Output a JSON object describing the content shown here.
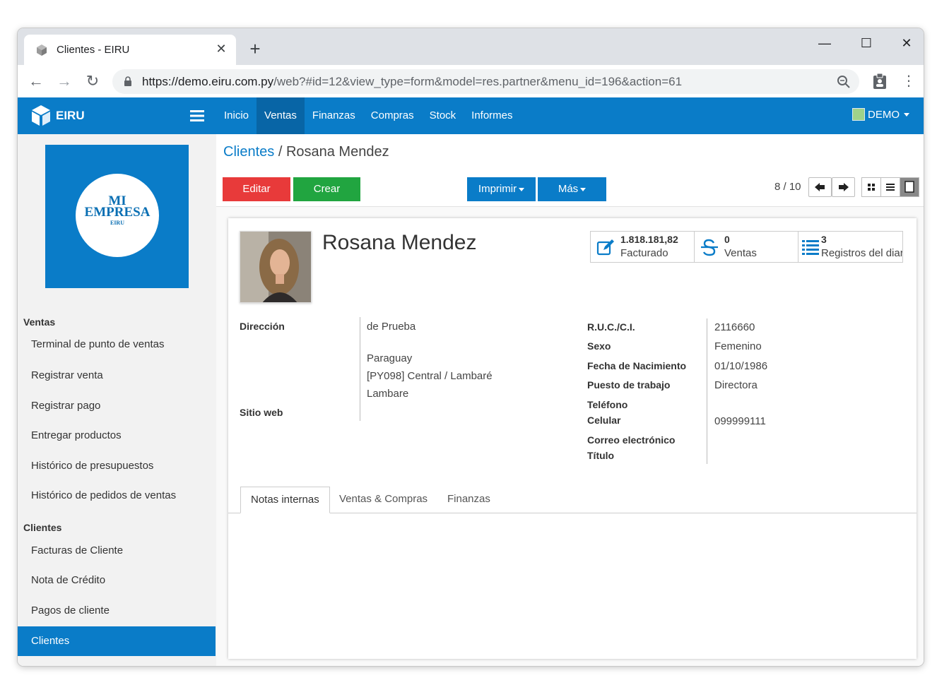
{
  "browser": {
    "tab_title": "Clientes - EIRU",
    "url_host": "https://demo.eiru.com.py",
    "url_rest": "/web?#id=12&view_type=form&model=res.partner&menu_id=196&action=61"
  },
  "navbar": {
    "brand": "EIRU",
    "menu": [
      "Inicio",
      "Ventas",
      "Finanzas",
      "Compras",
      "Stock",
      "Informes"
    ],
    "active_menu": "Ventas",
    "user": "DEMO"
  },
  "sidebar": {
    "logo": {
      "line1": "MI",
      "line2": "EMPRESA",
      "line3": "EIRU"
    },
    "sections": [
      {
        "title": "Ventas",
        "items": [
          "Terminal de punto de ventas",
          "Registrar venta",
          "Registrar pago",
          "Entregar productos",
          "Histórico de presupuestos",
          "Histórico de pedidos de ventas"
        ]
      },
      {
        "title": "Clientes",
        "items": [
          "Facturas de Cliente",
          "Nota de Crédito",
          "Pagos de cliente",
          "Clientes"
        ]
      }
    ],
    "active_item": "Clientes"
  },
  "breadcrumb": {
    "parent": "Clientes",
    "separator": " / ",
    "current": "Rosana Mendez"
  },
  "buttons": {
    "edit": "Editar",
    "create": "Crear",
    "print": "Imprimir",
    "more": "Más"
  },
  "pager": "8 / 10",
  "partner": {
    "name": "Rosana Mendez",
    "stats": [
      {
        "value": "1.818.181,82",
        "label": "Facturado"
      },
      {
        "value": "0",
        "label": "Ventas"
      },
      {
        "value": "3",
        "label": "Registros del diario"
      }
    ],
    "address_label": "Dirección",
    "address": [
      "de Prueba",
      "Paraguay",
      "[PY098] Central / Lambaré",
      "Lambare"
    ],
    "website_label": "Sitio web",
    "fields": [
      {
        "label": "R.U.C./C.I.",
        "value": "2116660"
      },
      {
        "label": "Sexo",
        "value": "Femenino"
      },
      {
        "label": "Fecha de Nacimiento",
        "value": "01/10/1986"
      },
      {
        "label": "Puesto de trabajo",
        "value": "Directora"
      },
      {
        "label": "Teléfono",
        "value": ""
      },
      {
        "label": "Celular",
        "value": "099999111"
      },
      {
        "label": "Correo electrónico",
        "value": ""
      },
      {
        "label": "Título",
        "value": ""
      }
    ]
  },
  "form_tabs": [
    "Notas internas",
    "Ventas & Compras",
    "Finanzas"
  ],
  "colors": {
    "primary": "#0a7cc8",
    "edit": "#e83a3a",
    "create": "#21a540"
  }
}
